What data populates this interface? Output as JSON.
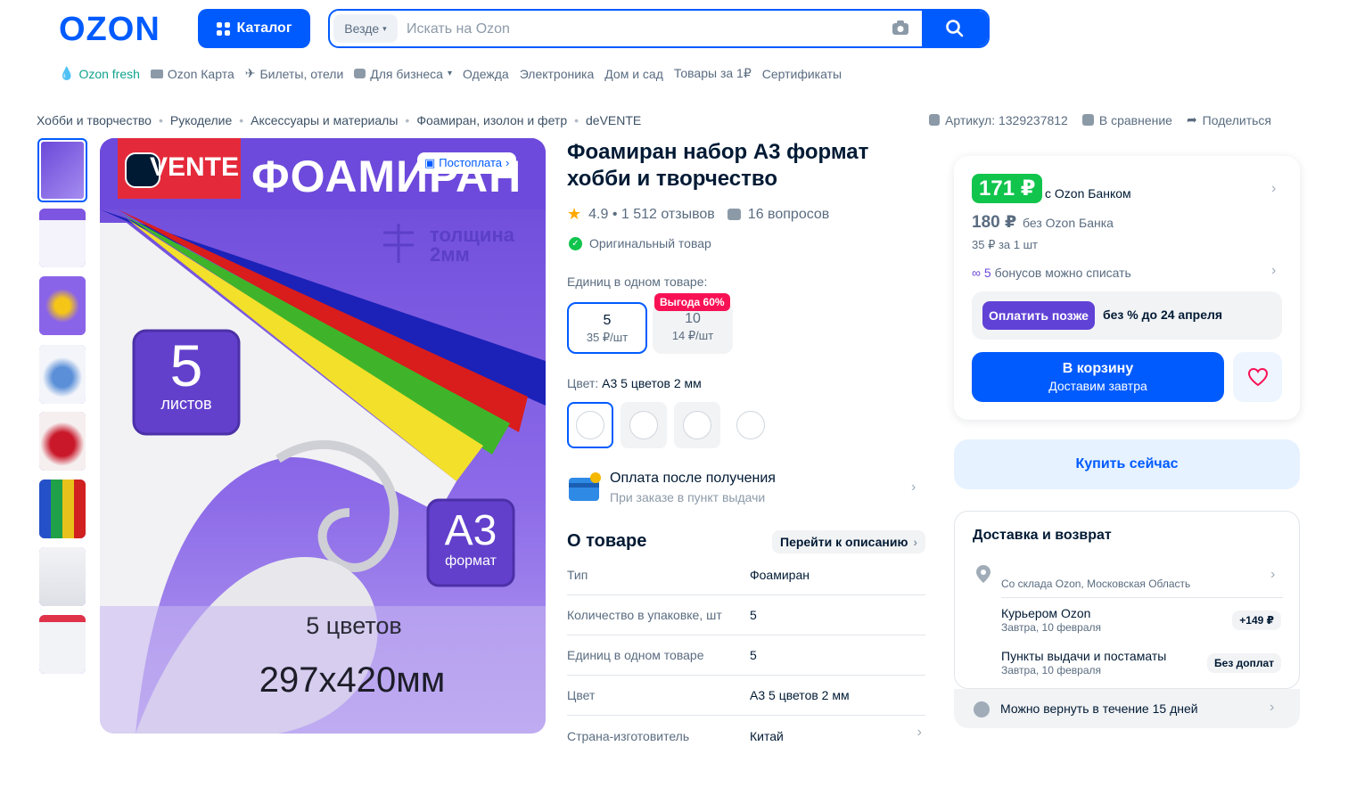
{
  "header": {
    "logo": "OZON",
    "catalog_label": "Каталог",
    "search_scope": "Везде",
    "search_placeholder": "Искать на Ozon"
  },
  "nav": [
    "Ozon fresh",
    "Ozon Карта",
    "Билеты, отели",
    "Для бизнеса",
    "Одежда",
    "Электроника",
    "Дом и сад",
    "Товары за 1₽",
    "Сертификаты"
  ],
  "breadcrumbs": [
    "Хобби и творчество",
    "Рукоделие",
    "Аксессуары и материалы",
    "Фоамиран, изолон и фетр",
    "deVENTE"
  ],
  "actions": {
    "article": "Артикул: 1329237812",
    "compare": "В сравнение",
    "share": "Поделиться"
  },
  "image": {
    "badge": "Постоплата",
    "brand": "VENTE",
    "headline": "ФОАМИРАН",
    "thickness_label": "толщина",
    "thickness_value": "2мм",
    "sheets_num": "5",
    "sheets_label": "листов",
    "format_big": "А3",
    "format_label": "формат",
    "colors_text": "5 цветов",
    "size_text": "297x420мм"
  },
  "product": {
    "title": "Фоамиран набор А3 формат хобби и творчество",
    "rating": "4.9 • 1 512 отзывов",
    "questions": "16 вопросов",
    "original": "Оригинальный товар",
    "units_label": "Единиц в одном товаре:",
    "units": [
      {
        "count": "5",
        "price": "35 ₽/шт"
      },
      {
        "count": "10",
        "price": "14 ₽/шт"
      }
    ],
    "units_badge": "Выгода 60%",
    "color_label": "Цвет:",
    "color_value": "А3 5 цветов 2 мм",
    "pay_title": "Оплата после получения",
    "pay_sub": "При заказе в пункт выдачи",
    "about": "О товаре",
    "goto_desc": "Перейти к описанию",
    "specs": [
      {
        "k": "Тип",
        "v": "Фоамиран"
      },
      {
        "k": "Количество в упаковке, шт",
        "v": "5"
      },
      {
        "k": "Единиц в одном товаре",
        "v": "5"
      },
      {
        "k": "Цвет",
        "v": "А3 5 цветов 2 мм"
      },
      {
        "k": "Страна-изготовитель",
        "v": "Китай"
      }
    ]
  },
  "price": {
    "card_price": "171 ₽",
    "card_label": "с Ozon Банком",
    "regular_price": "180 ₽",
    "regular_label": "без Ozon Банка",
    "per_unit": "35 ₽ за 1 шт",
    "bonus_num": "5",
    "bonus_text": "бонусов можно списать",
    "pay_later_btn": "Оплатить позже",
    "pay_later_text": "без % до 24 апреля",
    "cart_label": "В корзину",
    "cart_sub": "Доставим завтра",
    "buy_now": "Купить сейчас"
  },
  "delivery": {
    "title": "Доставка и возврат",
    "warehouse": "Со склада Ozon, Московская Область",
    "courier": "Курьером Ozon",
    "courier_date": "Завтра, 10 февраля",
    "courier_tag": "+149 ₽",
    "pickup": "Пункты выдачи и постаматы",
    "pickup_date": "Завтра, 10 февраля",
    "pickup_tag": "Без доплат",
    "return": "Можно вернуть в течение 15 дней"
  },
  "colors": {
    "accent": "#005bff",
    "green": "#10c44c",
    "purple": "#6042d6",
    "pink": "#f91155"
  }
}
